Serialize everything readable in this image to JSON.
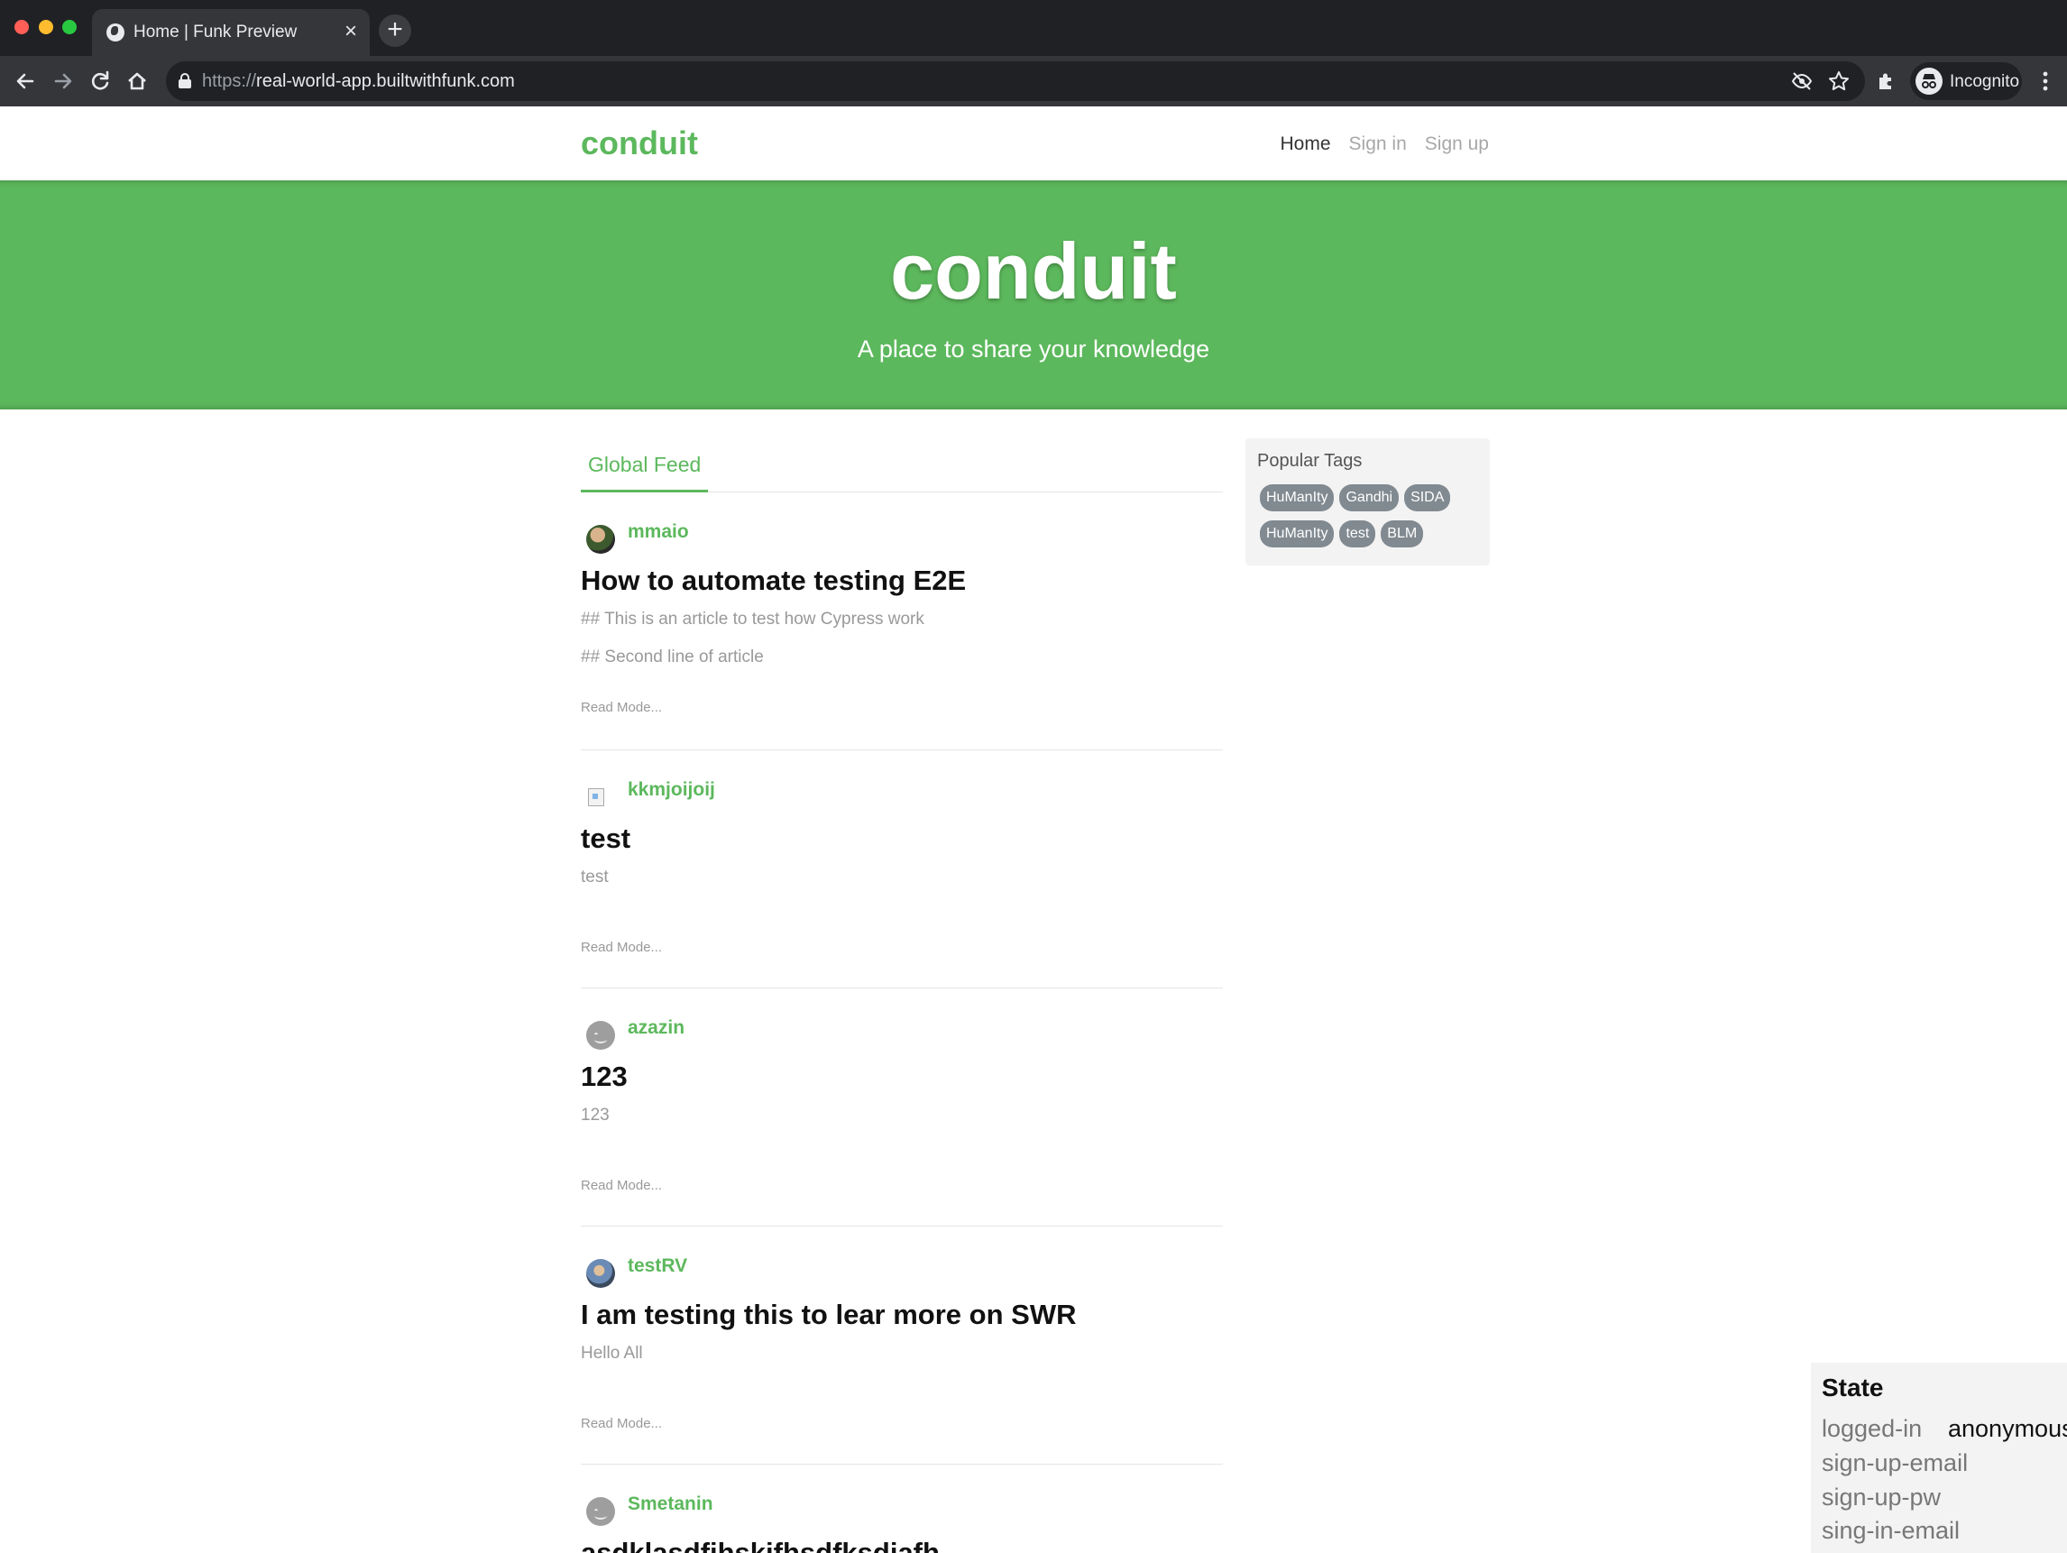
{
  "browser": {
    "tab_title": "Home | Funk Preview",
    "tab_close": "×",
    "new_tab": "+",
    "url_scheme": "https://",
    "url_host": "real-world-app.builtwithfunk.com",
    "profile_label": "Incognito",
    "icons": [
      "back-arrow",
      "forward-arrow",
      "reload",
      "home",
      "lock",
      "eye-off",
      "star",
      "puzzle",
      "incognito",
      "kebab-menu"
    ]
  },
  "nav": {
    "brand": "conduit",
    "links": [
      "Home",
      "Sign in",
      "Sign up"
    ]
  },
  "banner": {
    "title": "conduit",
    "subtitle": "A place to share your knowledge"
  },
  "feed": {
    "tab": "Global Feed",
    "articles": [
      {
        "author": "mmaio",
        "title": "How to automate testing E2E",
        "description_lines": [
          "## This is an article to test how Cypress work",
          "## Second line of article"
        ],
        "read_more": "Read Mode..."
      },
      {
        "author": "kkmjoijoij",
        "title": "test",
        "description_lines": [
          "test"
        ],
        "read_more": "Read Mode..."
      },
      {
        "author": "azazin",
        "title": "123",
        "description_lines": [
          "123"
        ],
        "read_more": "Read Mode..."
      },
      {
        "author": "testRV",
        "title": "I am testing this to lear more on SWR",
        "description_lines": [
          "Hello All"
        ],
        "read_more": "Read Mode..."
      },
      {
        "author": "Smetanin",
        "title": "asdklasdfjhskjfhsdfksdjafh",
        "description_lines": [],
        "read_more": ""
      }
    ]
  },
  "sidebar": {
    "title": "Popular Tags",
    "tags": [
      "HuManIty",
      "Gandhi",
      "SIDA",
      "HuManIty",
      "test",
      "BLM"
    ]
  },
  "state_panel": {
    "title": "State",
    "rows": [
      {
        "key": "logged-in",
        "value": "anonymous"
      },
      {
        "key": "sign-up-email",
        "value": ""
      },
      {
        "key": "sign-up-pw",
        "value": ""
      },
      {
        "key": "sing-in-email",
        "value": ""
      }
    ]
  },
  "colors": {
    "brand_green": "#5cb85c",
    "tag_gray": "#818a91",
    "chrome_dark": "#202124"
  }
}
